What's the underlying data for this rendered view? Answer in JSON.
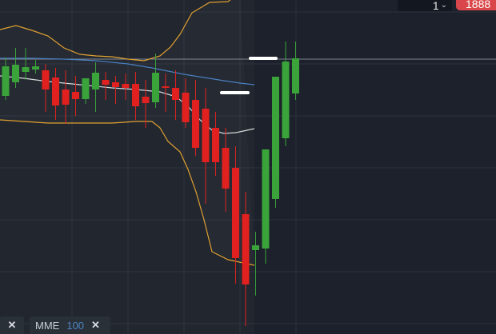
{
  "toolbar": {
    "quantity_value": "1",
    "price_tag": "1888"
  },
  "indicators": [
    {
      "name": "",
      "close_icon": "close-icon"
    },
    {
      "name": "MME",
      "period": "100",
      "close_icon": "close-icon"
    }
  ],
  "colors": {
    "background": "#1c212b",
    "grid": "#2b313c",
    "bull": "#3aa33a",
    "bear": "#e0211f",
    "band": "#e0a030",
    "ema_blue": "#4a7fc0",
    "sma_white": "#d8d8d8",
    "price_line": "#7d8590",
    "price_tag_bg": "#d9474a"
  },
  "chart_data": {
    "type": "candlestick",
    "title": "",
    "xlabel": "",
    "ylabel": "",
    "y_axis_inverted_units": "relative",
    "ylim": [
      0,
      418
    ],
    "candles": [
      {
        "o": 120,
        "h": 72,
        "c": 83,
        "l": 125
      },
      {
        "o": 103,
        "h": 60,
        "c": 81,
        "l": 110
      },
      {
        "o": 90,
        "h": 60,
        "c": 84,
        "l": 100
      },
      {
        "o": 87,
        "h": 75,
        "c": 83,
        "l": 92
      },
      {
        "o": 88,
        "h": 80,
        "c": 112,
        "l": 140
      },
      {
        "o": 97,
        "h": 85,
        "c": 132,
        "l": 150
      },
      {
        "o": 112,
        "h": 88,
        "c": 131,
        "l": 155
      },
      {
        "o": 115,
        "h": 95,
        "c": 124,
        "l": 145
      },
      {
        "o": 124,
        "h": 98,
        "c": 98,
        "l": 130
      },
      {
        "o": 112,
        "h": 78,
        "c": 91,
        "l": 140
      },
      {
        "o": 100,
        "h": 90,
        "c": 106,
        "l": 125
      },
      {
        "o": 103,
        "h": 95,
        "c": 109,
        "l": 130
      },
      {
        "o": 105,
        "h": 92,
        "c": 110,
        "l": 125
      },
      {
        "o": 105,
        "h": 90,
        "c": 133,
        "l": 150
      },
      {
        "o": 121,
        "h": 100,
        "c": 129,
        "l": 160
      },
      {
        "o": 128,
        "h": 67,
        "c": 91,
        "l": 135
      },
      {
        "o": 108,
        "h": 92,
        "c": 110,
        "l": 140
      },
      {
        "o": 110,
        "h": 88,
        "c": 125,
        "l": 150
      },
      {
        "o": 116,
        "h": 98,
        "c": 153,
        "l": 160
      },
      {
        "o": 125,
        "h": 100,
        "c": 185,
        "l": 195
      },
      {
        "o": 136,
        "h": 110,
        "c": 203,
        "l": 255
      },
      {
        "o": 160,
        "h": 140,
        "c": 203,
        "l": 220
      },
      {
        "o": 185,
        "h": 160,
        "c": 236,
        "l": 265
      },
      {
        "o": 210,
        "h": 183,
        "c": 323,
        "l": 355
      },
      {
        "o": 268,
        "h": 240,
        "c": 356,
        "l": 408
      },
      {
        "o": 313,
        "h": 290,
        "c": 307,
        "l": 370
      },
      {
        "o": 311,
        "h": 240,
        "c": 187,
        "l": 330
      },
      {
        "o": 249,
        "h": 110,
        "c": 96,
        "l": 260
      },
      {
        "o": 173,
        "h": 52,
        "c": 77,
        "l": 183
      },
      {
        "o": 117,
        "h": 52,
        "c": 73,
        "l": 125
      }
    ],
    "upper_band": [
      [
        0,
        37
      ],
      [
        20,
        32
      ],
      [
        40,
        38
      ],
      [
        60,
        45
      ],
      [
        80,
        60
      ],
      [
        100,
        68
      ],
      [
        120,
        70
      ],
      [
        140,
        71
      ],
      [
        160,
        74
      ],
      [
        180,
        76
      ],
      [
        200,
        70
      ],
      [
        213,
        59
      ],
      [
        225,
        43
      ],
      [
        240,
        16
      ],
      [
        262,
        3
      ],
      [
        285,
        2
      ],
      [
        300,
        -10
      ]
    ],
    "lower_band": [
      [
        0,
        150
      ],
      [
        30,
        152
      ],
      [
        60,
        154
      ],
      [
        100,
        154
      ],
      [
        140,
        154
      ],
      [
        170,
        152
      ],
      [
        190,
        152
      ],
      [
        200,
        160
      ],
      [
        210,
        177
      ],
      [
        225,
        190
      ],
      [
        235,
        212
      ],
      [
        245,
        240
      ],
      [
        255,
        275
      ],
      [
        265,
        315
      ],
      [
        285,
        325
      ],
      [
        318,
        332
      ]
    ],
    "ema": [
      [
        0,
        73
      ],
      [
        40,
        73
      ],
      [
        80,
        74
      ],
      [
        120,
        76
      ],
      [
        160,
        80
      ],
      [
        190,
        85
      ],
      [
        210,
        89
      ],
      [
        230,
        93
      ],
      [
        255,
        97
      ],
      [
        280,
        101
      ],
      [
        300,
        104
      ],
      [
        318,
        106
      ]
    ],
    "sma": [
      [
        0,
        95
      ],
      [
        30,
        98
      ],
      [
        60,
        102
      ],
      [
        100,
        106
      ],
      [
        140,
        110
      ],
      [
        170,
        112
      ],
      [
        200,
        115
      ],
      [
        220,
        121
      ],
      [
        235,
        133
      ],
      [
        250,
        150
      ],
      [
        265,
        163
      ],
      [
        280,
        167
      ],
      [
        295,
        166
      ],
      [
        318,
        161
      ]
    ],
    "price_line_level": 74,
    "markers": [
      {
        "label": "",
        "from": 277,
        "to": 310,
        "level": 116
      },
      {
        "label": "",
        "from": 313,
        "to": 345,
        "level": 73
      }
    ]
  }
}
